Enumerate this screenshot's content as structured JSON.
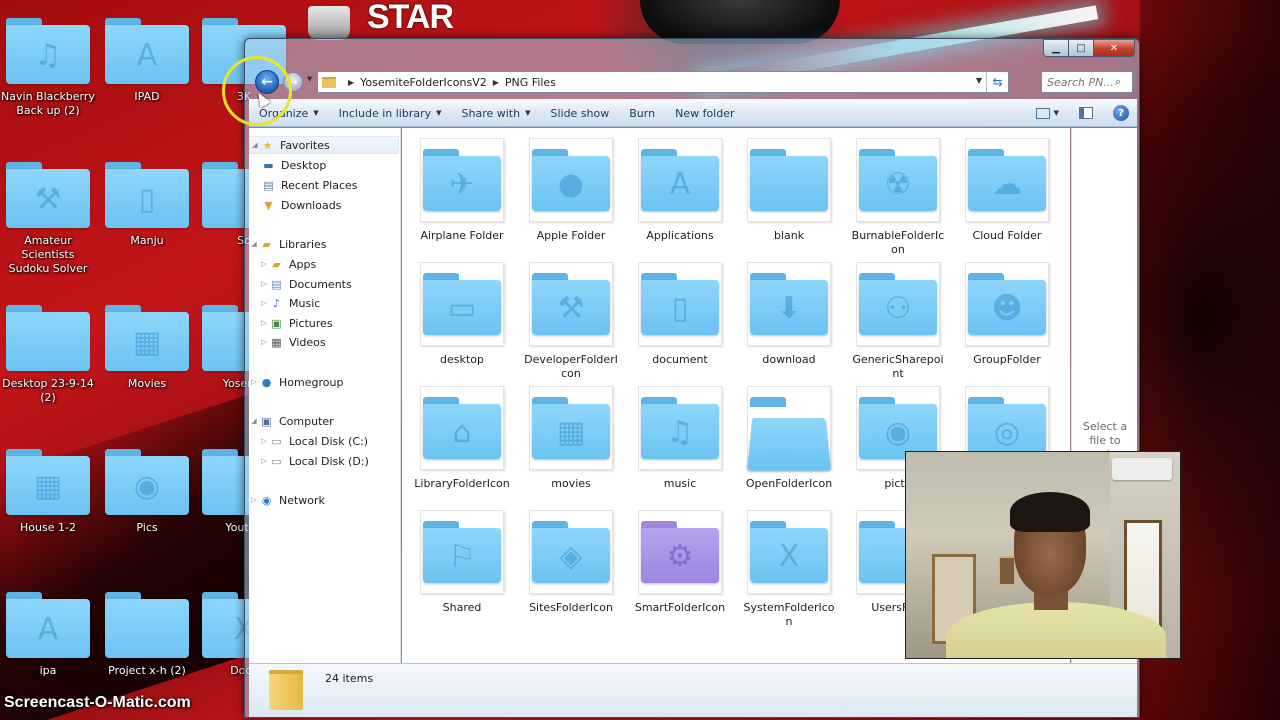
{
  "colors": {
    "folder_blue": "#8ed6fb",
    "folder_purple": "#b7a3f0",
    "window_glass": "#aacdeb",
    "commandbar_text": "#1e395b"
  },
  "wallpaper": {
    "logo_text": "STAR\nWARS"
  },
  "desktop_icons": [
    {
      "label": "Navin Blackberry Back up (2)",
      "glyph": "♫",
      "icon": "music-icon"
    },
    {
      "label": "IPAD",
      "glyph": "A",
      "icon": "app-store-icon"
    },
    {
      "label": "3K",
      "glyph": "",
      "icon": "folder-icon"
    },
    {
      "label": "Amateur Scientists Sudoku Solver",
      "glyph": "⚒",
      "icon": "hammer-icon"
    },
    {
      "label": "Manju",
      "glyph": "▯",
      "icon": "document-icon"
    },
    {
      "label": "So",
      "glyph": "",
      "icon": "folder-icon"
    },
    {
      "label": "Desktop 23-9-14 (2)",
      "glyph": "",
      "icon": "folder-icon"
    },
    {
      "label": "Movies",
      "glyph": "▦",
      "icon": "film-icon"
    },
    {
      "label": "Yosemit",
      "glyph": "",
      "icon": "folder-icon"
    },
    {
      "label": "House 1-2",
      "glyph": "▦",
      "icon": "film-icon"
    },
    {
      "label": "Pics",
      "glyph": "◉",
      "icon": "camera-icon"
    },
    {
      "label": "Youtub",
      "glyph": "",
      "icon": "folder-icon"
    },
    {
      "label": "ipa",
      "glyph": "A",
      "icon": "app-store-icon"
    },
    {
      "label": "Project x-h (2)",
      "glyph": "",
      "icon": "folder-icon"
    },
    {
      "label": "Dock",
      "glyph": "X",
      "icon": "x-icon"
    }
  ],
  "window": {
    "caption": {
      "minimize": "▁",
      "maximize": "□",
      "close": "✕"
    },
    "breadcrumb": [
      "YosemiteFolderIconsV2",
      "PNG Files"
    ],
    "search_placeholder": "Search PN...",
    "commands": [
      {
        "label": "Organize",
        "has_arrow": true
      },
      {
        "label": "Include in library",
        "has_arrow": true
      },
      {
        "label": "Share with",
        "has_arrow": true
      },
      {
        "label": "Slide show",
        "has_arrow": false
      },
      {
        "label": "Burn",
        "has_arrow": false
      },
      {
        "label": "New folder",
        "has_arrow": false
      }
    ],
    "help_label": "?",
    "nav": {
      "favorites": "Favorites",
      "desktop": "Desktop",
      "recent_places": "Recent Places",
      "downloads": "Downloads",
      "libraries": "Libraries",
      "apps": "Apps",
      "documents": "Documents",
      "music": "Music",
      "pictures": "Pictures",
      "videos": "Videos",
      "homegroup": "Homegroup",
      "computer": "Computer",
      "local_c": "Local Disk (C:)",
      "local_d": "Local Disk (D:)",
      "network": "Network"
    },
    "files": [
      {
        "label": "Airplane Folder",
        "glyph": "✈",
        "icon": "airplane-icon"
      },
      {
        "label": "Apple Folder",
        "glyph": "●",
        "icon": "apple-icon"
      },
      {
        "label": "Applications",
        "glyph": "A",
        "icon": "app-store-icon"
      },
      {
        "label": "blank",
        "glyph": "",
        "icon": "folder-icon"
      },
      {
        "label": "BurnableFolderIcon",
        "glyph": "☢",
        "icon": "radiation-icon"
      },
      {
        "label": "Cloud Folder",
        "glyph": "☁",
        "icon": "cloud-icon"
      },
      {
        "label": "desktop",
        "glyph": "▭",
        "icon": "monitor-icon"
      },
      {
        "label": "DeveloperFolderIcon",
        "glyph": "⚒",
        "icon": "hammer-icon"
      },
      {
        "label": "document",
        "glyph": "▯",
        "icon": "document-icon"
      },
      {
        "label": "download",
        "glyph": "⬇",
        "icon": "download-icon"
      },
      {
        "label": "GenericSharepoint",
        "glyph": "⚇",
        "icon": "people-icon"
      },
      {
        "label": "GroupFolder",
        "glyph": "☻",
        "icon": "group-icon"
      },
      {
        "label": "LibraryFolderIcon",
        "glyph": "⌂",
        "icon": "library-icon"
      },
      {
        "label": "movies",
        "glyph": "▦",
        "icon": "film-icon"
      },
      {
        "label": "music",
        "glyph": "♫",
        "icon": "music-icon"
      },
      {
        "label": "OpenFolderIcon",
        "glyph": "",
        "icon": "open-folder-icon",
        "open": true
      },
      {
        "label": "pictu",
        "glyph": "◉",
        "icon": "camera-icon"
      },
      {
        "label": "",
        "glyph": "◎",
        "icon": "fingerprint-icon"
      },
      {
        "label": "Shared",
        "glyph": "⚐",
        "icon": "shared-icon"
      },
      {
        "label": "SitesFolderIcon",
        "glyph": "◈",
        "icon": "compass-icon"
      },
      {
        "label": "SmartFolderIcon",
        "glyph": "⚙",
        "icon": "gear-icon",
        "purple": true
      },
      {
        "label": "SystemFolderIcon",
        "glyph": "X",
        "icon": "x-icon"
      },
      {
        "label": "UsersFold",
        "glyph": "",
        "icon": "folder-icon"
      }
    ],
    "preview_message": "Select a file to preview.",
    "item_count": "24 items"
  },
  "watermark": "Screencast-O-Matic.com"
}
